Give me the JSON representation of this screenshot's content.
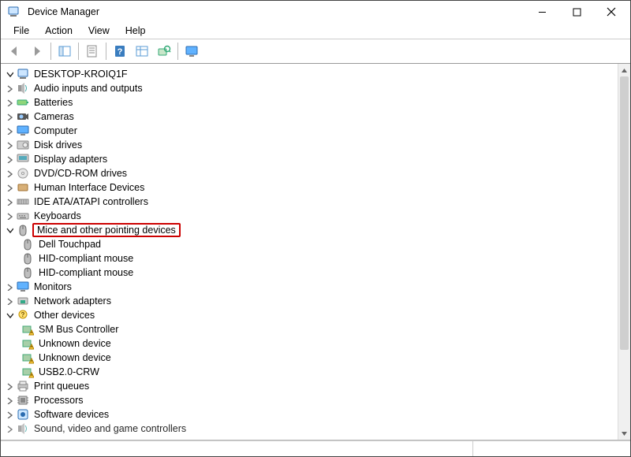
{
  "window": {
    "title": "Device Manager"
  },
  "menus": {
    "file": "File",
    "action": "Action",
    "view": "View",
    "help": "Help"
  },
  "tree": {
    "root": "DESKTOP-KROIQ1F",
    "cat": {
      "audio": "Audio inputs and outputs",
      "batteries": "Batteries",
      "cameras": "Cameras",
      "computer": "Computer",
      "disk": "Disk drives",
      "display": "Display adapters",
      "dvd": "DVD/CD-ROM drives",
      "hid": "Human Interface Devices",
      "ide": "IDE ATA/ATAPI controllers",
      "keyboards": "Keyboards",
      "mice": "Mice and other pointing devices",
      "monitors": "Monitors",
      "network": "Network adapters",
      "other": "Other devices",
      "print": "Print queues",
      "processors": "Processors",
      "software": "Software devices",
      "sound": "Sound, video and game controllers"
    },
    "mice_children": {
      "dell": "Dell Touchpad",
      "hid1": "HID-compliant mouse",
      "hid2": "HID-compliant mouse"
    },
    "other_children": {
      "sm": "SM Bus Controller",
      "u1": "Unknown device",
      "u2": "Unknown device",
      "usb": "USB2.0-CRW"
    }
  }
}
